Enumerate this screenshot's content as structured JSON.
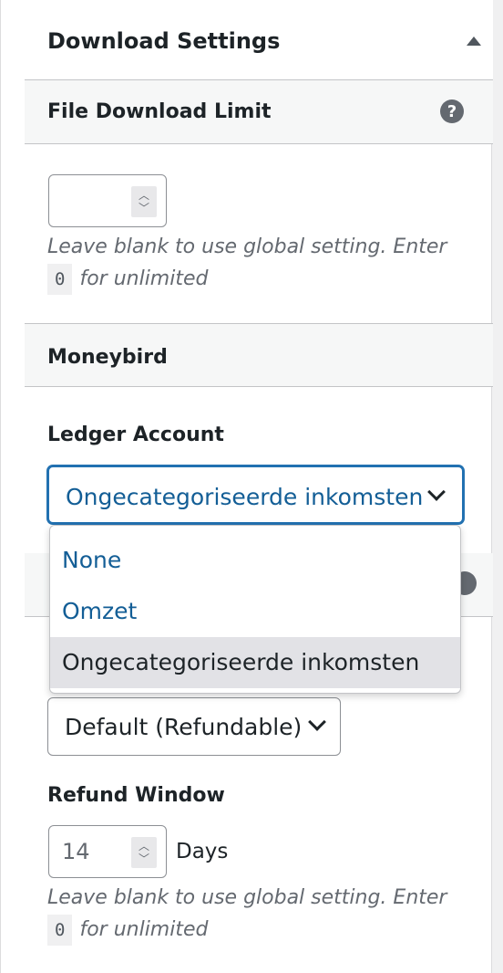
{
  "panel": {
    "title": "Download Settings"
  },
  "file_download_limit": {
    "heading": "File Download Limit",
    "value": "",
    "help_prefix": "Leave blank to use global setting. Enter",
    "help_code": "0",
    "help_suffix": "for unlimited"
  },
  "moneybird": {
    "heading": "Moneybird",
    "ledger_label": "Ledger Account",
    "ledger_selected": "Ongecategoriseerde inkomsten",
    "ledger_options": [
      "None",
      "Omzet",
      "Ongecategoriseerde inkomsten"
    ]
  },
  "refund": {
    "status_selected": "Default (Refundable)",
    "window_label": "Refund Window",
    "window_value": "14",
    "window_unit": "Days",
    "help_prefix": "Leave blank to use global setting. Enter",
    "help_code": "0",
    "help_suffix": "for unlimited"
  },
  "colors": {
    "accent": "#2271b1",
    "link": "#135e96",
    "muted": "#646970"
  }
}
